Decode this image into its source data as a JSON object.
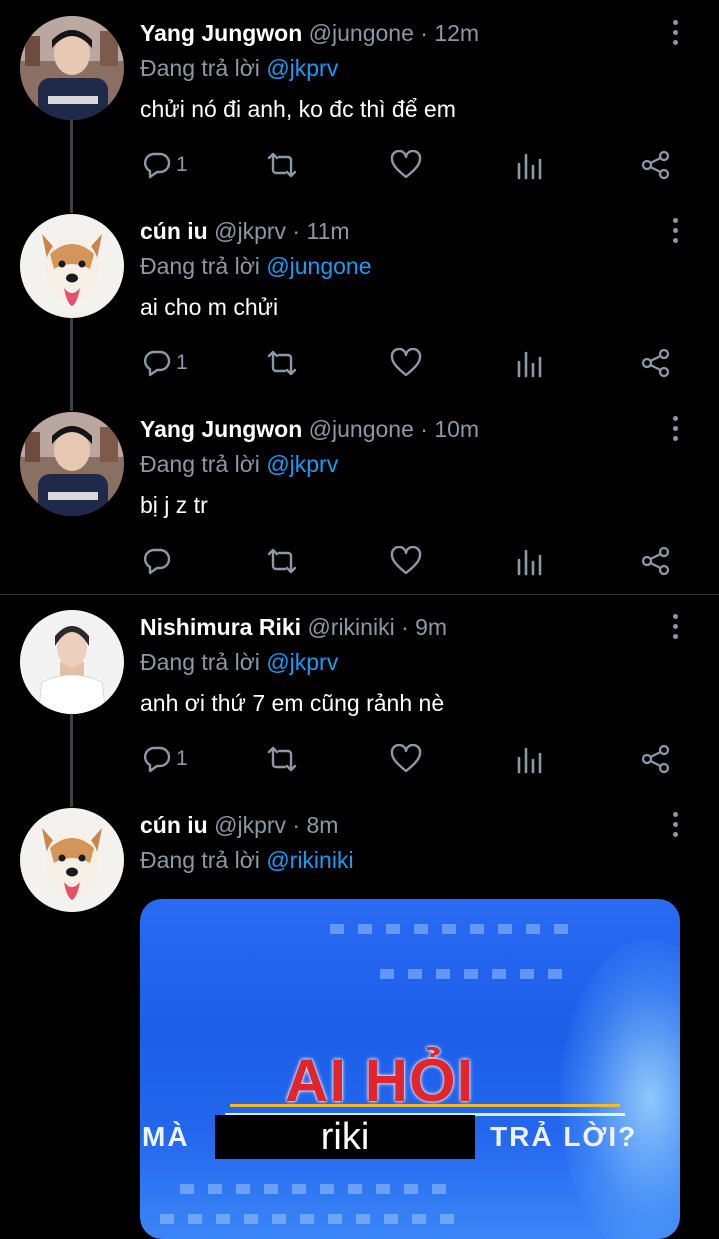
{
  "tweets": [
    {
      "name": "Yang Jungwon",
      "handle": "@jungone",
      "sep": " · ",
      "time": "12m",
      "reply_prefix": "Đang trả lời ",
      "reply_to": "@jkprv",
      "text": "chửi nó đi anh, ko đc thì để em",
      "reply_count": "1",
      "avatar": "person-photo"
    },
    {
      "name": "cún iu",
      "handle": "@jkprv",
      "sep": " · ",
      "time": "11m",
      "reply_prefix": "Đang trả lời ",
      "reply_to": "@jungone",
      "text": "ai cho m chửi",
      "reply_count": "1",
      "avatar": "dog-photo"
    },
    {
      "name": "Yang Jungwon",
      "handle": "@jungone",
      "sep": " · ",
      "time": "10m",
      "reply_prefix": "Đang trả lời ",
      "reply_to": "@jkprv",
      "text": "bị j z tr",
      "reply_count": "",
      "avatar": "person-photo"
    },
    {
      "name": "Nishimura Riki",
      "handle": "@rikiniki",
      "sep": " · ",
      "time": "9m",
      "reply_prefix": "Đang trả lời ",
      "reply_to": "@jkprv",
      "text": "anh ơi thứ 7 em cũng rảnh nè",
      "reply_count": "1",
      "avatar": "person-photo"
    },
    {
      "name": "cún iu",
      "handle": "@jkprv",
      "sep": " · ",
      "time": "8m",
      "reply_prefix": "Đang trả lời ",
      "reply_to": "@rikiniki",
      "text": "",
      "reply_count": "",
      "avatar": "dog-photo"
    }
  ],
  "media": {
    "title": "AI HỎI",
    "left_text": "MÀ",
    "box_text": "riki",
    "right_text": "TRẢ LỜI?"
  },
  "colors": {
    "background": "#000000",
    "mention": "#1d9bf0",
    "muted": "#8b98a5",
    "thread_line": "#3e4144"
  },
  "icons": [
    "reply-icon",
    "retweet-icon",
    "like-icon",
    "views-icon",
    "share-icon",
    "more-icon"
  ]
}
